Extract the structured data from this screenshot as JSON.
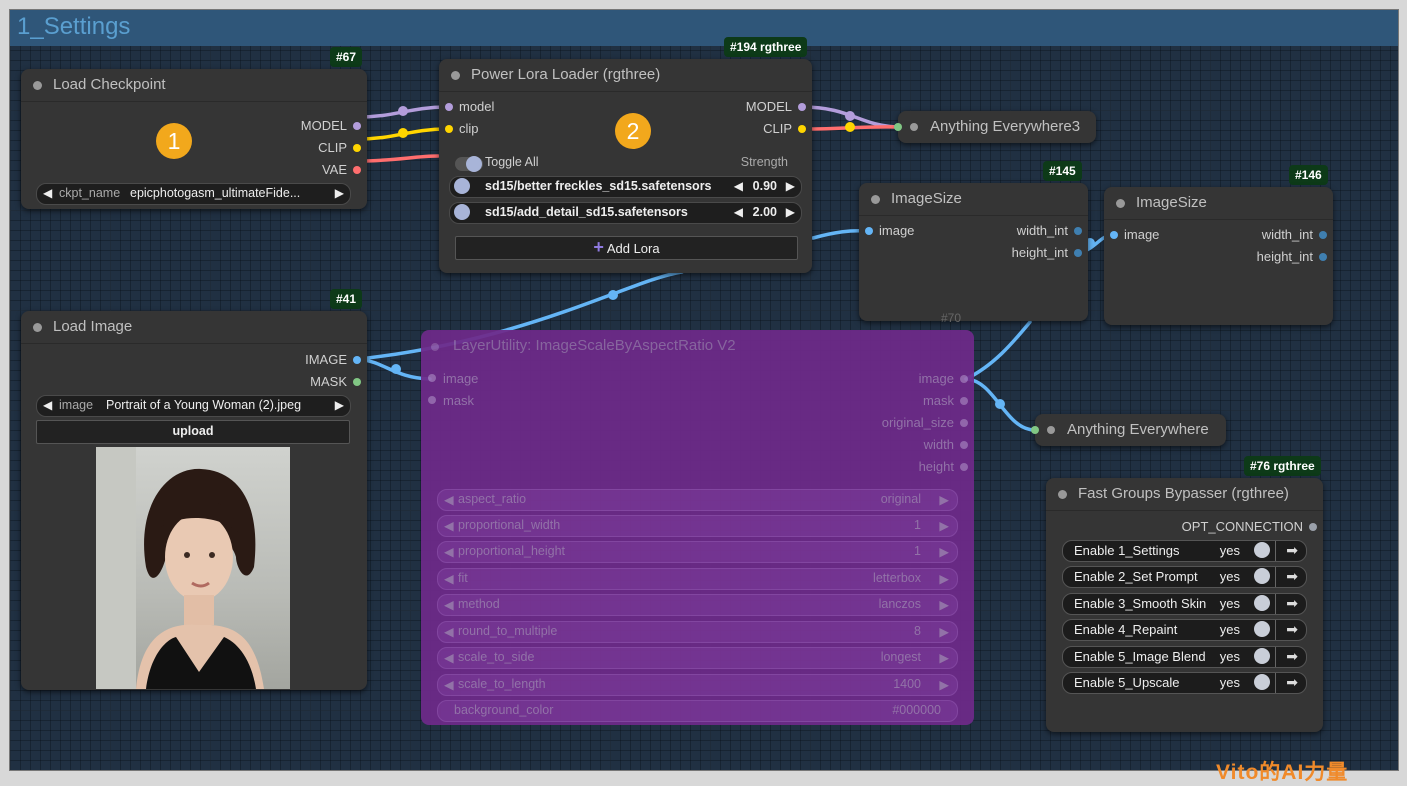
{
  "group": {
    "title": "1_Settings"
  },
  "load_checkpoint": {
    "badge": "#67",
    "title": "Load Checkpoint",
    "outputs": [
      "MODEL",
      "CLIP",
      "VAE"
    ],
    "marker": "1",
    "ckpt_label": "ckpt_name",
    "ckpt_value": "epicphotogasm_ultimateFide..."
  },
  "lora_loader": {
    "badge": "#194 rgthree",
    "title": "Power Lora Loader (rgthree)",
    "inputs": [
      "model",
      "clip"
    ],
    "outputs": [
      "MODEL",
      "CLIP"
    ],
    "marker": "2",
    "toggle_all": "Toggle All",
    "strength_header": "Strength",
    "loras": [
      {
        "name": "sd15/better freckles_sd15.safetensors",
        "strength": "0.90"
      },
      {
        "name": "sd15/add_detail_sd15.safetensors",
        "strength": "2.00"
      }
    ],
    "add_lora": "Add Lora"
  },
  "anything_everywhere3": {
    "title": "Anything Everywhere3"
  },
  "image_size_a": {
    "badge": "#145",
    "title": "ImageSize",
    "input": "image",
    "outputs": [
      "width_int",
      "height_int"
    ],
    "footer": "#70"
  },
  "image_size_b": {
    "badge": "#146",
    "title": "ImageSize",
    "input": "image",
    "outputs": [
      "width_int",
      "height_int"
    ]
  },
  "load_image": {
    "badge": "#41",
    "title": "Load Image",
    "outputs": [
      "IMAGE",
      "MASK"
    ],
    "image_label": "image",
    "image_value": "Portrait of a Young Woman (2).jpeg",
    "upload": "upload"
  },
  "layer_utility": {
    "title": "LayerUtility: ImageScaleByAspectRatio V2",
    "inputs": [
      "image",
      "mask"
    ],
    "outputs": [
      "image",
      "mask",
      "original_size",
      "width",
      "height"
    ],
    "widgets": [
      {
        "label": "aspect_ratio",
        "value": "original"
      },
      {
        "label": "proportional_width",
        "value": "1"
      },
      {
        "label": "proportional_height",
        "value": "1"
      },
      {
        "label": "fit",
        "value": "letterbox"
      },
      {
        "label": "method",
        "value": "lanczos"
      },
      {
        "label": "round_to_multiple",
        "value": "8"
      },
      {
        "label": "scale_to_side",
        "value": "longest"
      },
      {
        "label": "scale_to_length",
        "value": "1400"
      }
    ],
    "bg_label": "background_color",
    "bg_value": "#000000"
  },
  "anything_everywhere": {
    "title": "Anything Everywhere"
  },
  "fast_groups_bypasser": {
    "badge": "#76 rgthree",
    "title": "Fast Groups Bypasser (rgthree)",
    "output": "OPT_CONNECTION",
    "rows": [
      {
        "label": "Enable 1_Settings",
        "state": "yes"
      },
      {
        "label": "Enable 2_Set Prompt",
        "state": "yes"
      },
      {
        "label": "Enable 3_Smooth Skin",
        "state": "yes"
      },
      {
        "label": "Enable 4_Repaint",
        "state": "yes"
      },
      {
        "label": "Enable 5_Image Blend",
        "state": "yes"
      },
      {
        "label": "Enable 5_Upscale",
        "state": "yes"
      }
    ]
  },
  "watermark": "Vito的AI力量",
  "colors": {
    "model": "#b39ddb",
    "clip": "#ffd500",
    "vae": "#ff6e6e",
    "image": "#64b5f6",
    "mask": "#81c784",
    "group": "#2f5679",
    "badge": "#0d3a18",
    "bypassed": "#6e2a8a"
  }
}
